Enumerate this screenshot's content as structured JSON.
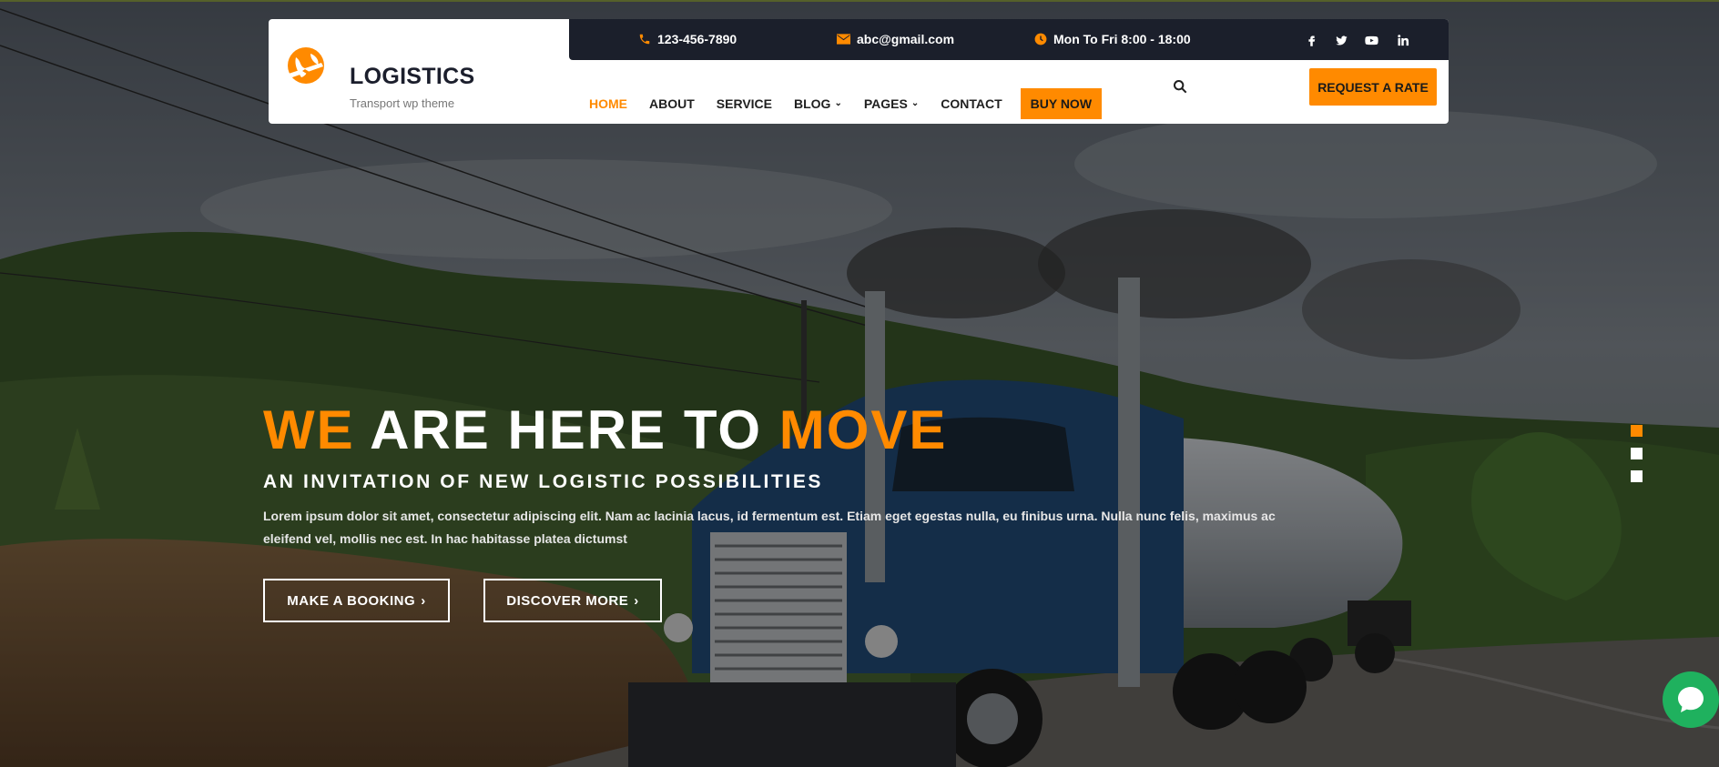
{
  "header": {
    "logo": {
      "title": "LOGISTICS",
      "subtitle": "Transport wp theme",
      "mark_icon": "globe-plane-icon"
    },
    "topbar": {
      "phone": {
        "icon": "phone-icon",
        "text": "123-456-7890"
      },
      "email": {
        "icon": "envelope-icon",
        "text": "abc@gmail.com"
      },
      "hours": {
        "icon": "clock-icon",
        "text": "Mon To Fri 8:00 - 18:00"
      },
      "social": [
        "facebook-icon",
        "twitter-icon",
        "youtube-icon",
        "linkedin-icon"
      ]
    },
    "nav": {
      "items": [
        {
          "label": "HOME",
          "active": true,
          "dropdown": false
        },
        {
          "label": "ABOUT",
          "active": false,
          "dropdown": false
        },
        {
          "label": "SERVICE",
          "active": false,
          "dropdown": false
        },
        {
          "label": "BLOG",
          "active": false,
          "dropdown": true
        },
        {
          "label": "PAGES",
          "active": false,
          "dropdown": true
        },
        {
          "label": "CONTACT",
          "active": false,
          "dropdown": false
        }
      ],
      "buy_now": "BUY NOW",
      "search_icon": "search-icon"
    },
    "request_rate": "REQUEST A RATE"
  },
  "hero": {
    "headline": {
      "word1": "WE",
      "middle": "ARE HERE TO",
      "word2": "MOVE"
    },
    "subheading": "AN INVITATION OF NEW LOGISTIC POSSIBILITIES",
    "description": "Lorem ipsum dolor sit amet, consectetur adipiscing elit. Nam ac lacinia lacus, id fermentum est. Etiam eget egestas nulla, eu finibus urna. Nulla nunc felis, maximus ac eleifend vel, mollis nec est. In hac habitasse platea dictumst",
    "buttons": {
      "booking": "MAKE A BOOKING",
      "discover": "DISCOVER MORE"
    },
    "slides": {
      "count": 3,
      "active_index": 0
    }
  },
  "chat": {
    "icon": "chat-bubble-icon"
  },
  "colors": {
    "accent": "#ff8a00",
    "topbar": "#1b1f2b",
    "chat": "#1fb15e",
    "text_dark": "#1f1f1f"
  }
}
